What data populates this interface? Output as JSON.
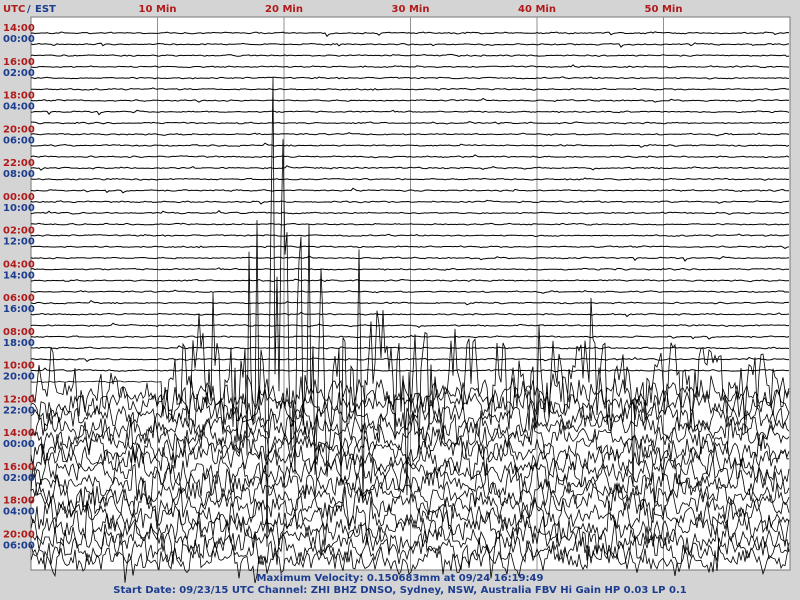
{
  "header": {
    "utc_label": "UTC",
    "slash": "/",
    "local_label": "EST"
  },
  "chart_data": {
    "type": "line",
    "title": "",
    "x_ticks": [
      {
        "label": "10 Min",
        "minute": 10
      },
      {
        "label": "20 Min",
        "minute": 20
      },
      {
        "label": "30 Min",
        "minute": 30
      },
      {
        "label": "40 Min",
        "minute": 40
      },
      {
        "label": "50 Min",
        "minute": 50
      }
    ],
    "xlim": [
      0,
      60
    ],
    "traces": 48,
    "utc_labels": [
      "14:00",
      "16:00",
      "18:00",
      "20:00",
      "22:00",
      "00:00",
      "02:00",
      "04:00",
      "06:00",
      "08:00",
      "10:00",
      "12:00",
      "14:00",
      "16:00",
      "18:00",
      "20:00"
    ],
    "est_labels": [
      "00:00",
      "02:00",
      "04:00",
      "06:00",
      "08:00",
      "10:00",
      "12:00",
      "14:00",
      "16:00",
      "18:00",
      "20:00",
      "22:00",
      "00:00",
      "02:00",
      "04:00",
      "06:00"
    ],
    "grid": true,
    "colors": {
      "utc": "#b01a1a",
      "local": "#1c3d8f",
      "trace": "#000000",
      "grid": "#909090",
      "background": "#ffffff",
      "frame": "#d4d4d4"
    },
    "event": {
      "onset_trace": 31,
      "onset_minute": 10.3,
      "peak_trace": 31,
      "peak_minute": 21.0
    }
  },
  "footer": {
    "line1": "Maximum Velocity: 0.150683mm at 09/24 16:19:49",
    "line2": "Start Date: 09/23/15 UTC Channel: ZHI  BHZ  DNSO, Sydney, NSW, Australia  FBV Hi Gain HP 0.03  LP 0.1"
  }
}
